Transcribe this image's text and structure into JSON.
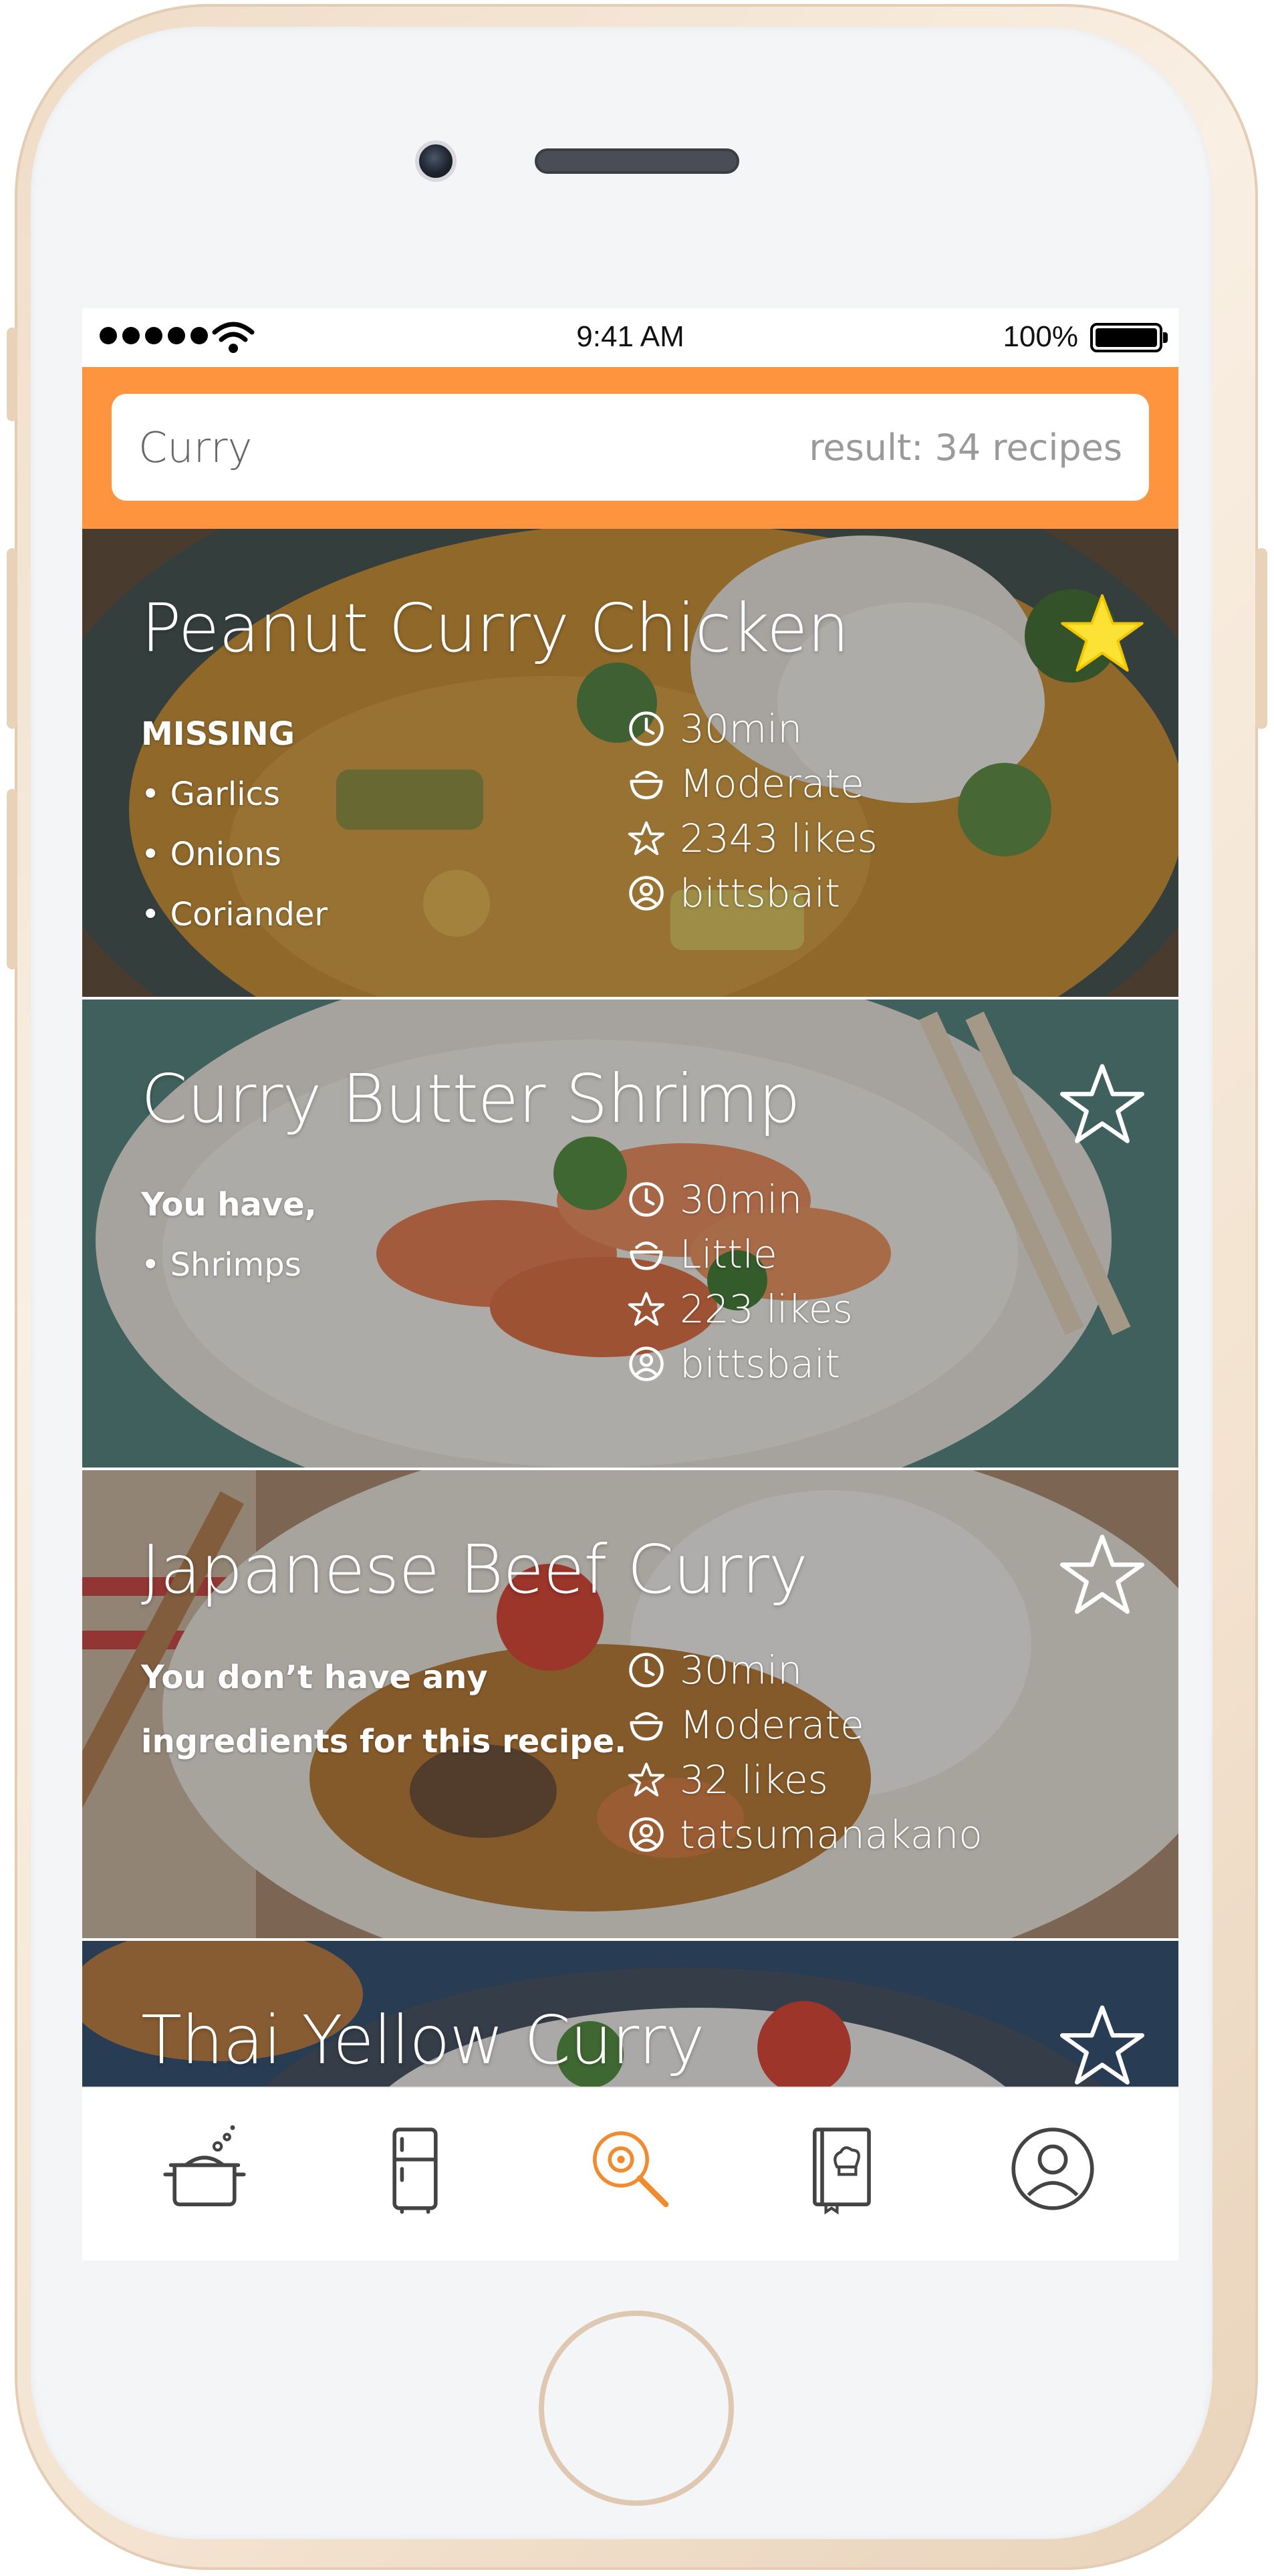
{
  "status_bar": {
    "time": "9:41 AM",
    "battery_percent": "100%"
  },
  "search": {
    "query": "Curry",
    "result_text": "result: 34 recipes"
  },
  "recipes": [
    {
      "title": "Peanut Curry Chicken",
      "favorited": true,
      "ingredients_header": "MISSING",
      "ingredients": [
        "• Garlics",
        "• Onions",
        "• Coriander"
      ],
      "time": "30min",
      "difficulty": "Moderate",
      "likes": "2343 likes",
      "author": "bittsbait"
    },
    {
      "title": "Curry Butter Shrimp",
      "favorited": false,
      "ingredients_header": "You have,",
      "ingredients": [
        "• Shrimps"
      ],
      "time": "30min",
      "difficulty": "Little",
      "likes": "223 likes",
      "author": "bittsbait"
    },
    {
      "title": "Japanese Beef Curry",
      "favorited": false,
      "ingredients_header": "You don’t have any",
      "ingredients_header_line2": "ingredients for this recipe.",
      "time": "30min",
      "difficulty": "Moderate",
      "likes": "32 likes",
      "author": "tatsumanakano"
    },
    {
      "title": "Thai Yellow Curry",
      "favorited": false
    }
  ],
  "tab_bar": {
    "active_tab": "search",
    "tabs": [
      "cooking-pot-icon",
      "fridge-icon",
      "search-recipe-icon",
      "recipe-book-icon",
      "profile-icon"
    ]
  },
  "colors": {
    "accent": "#ff943e",
    "favorite": "#fbe234",
    "active_tab": "#f28a2e",
    "inactive_tab": "#444444"
  }
}
